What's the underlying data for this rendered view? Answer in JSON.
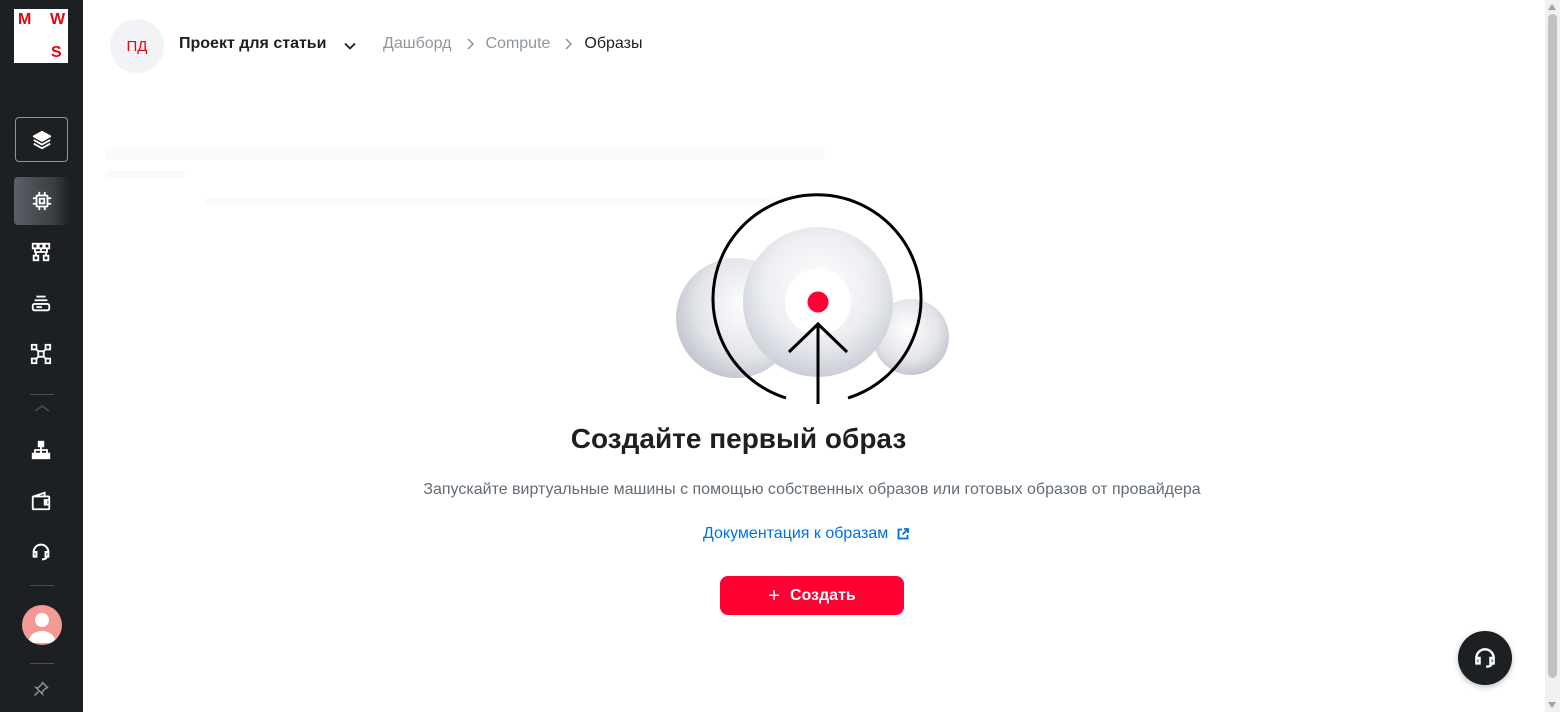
{
  "logo": {
    "letter_m": "M",
    "letter_w": "W",
    "letter_s": "S"
  },
  "sidebar": {
    "items": [
      {
        "name": "layers-icon"
      },
      {
        "name": "chip-icon",
        "active": true
      },
      {
        "name": "network-icon"
      },
      {
        "name": "storage-icon"
      },
      {
        "name": "kubernetes-icon"
      },
      {
        "name": "org-structure-icon"
      },
      {
        "name": "wallet-icon"
      },
      {
        "name": "headset-icon"
      }
    ],
    "pin_icon": "pin-icon"
  },
  "header": {
    "project_initials": "ПД",
    "project_name": "Проект для статьи",
    "breadcrumbs": [
      "Дашборд",
      "Compute",
      "Образы"
    ]
  },
  "empty_state": {
    "title": "Создайте первый образ",
    "description": "Запускайте виртуальные машины с помощью собственных образов или готовых образов от провайдера",
    "doc_link": "Документация к образам",
    "create_button": "Создать"
  },
  "colors": {
    "accent": "#ff0032",
    "link": "#0070e5",
    "sidebar_bg": "#1d2023",
    "brand_red": "#e30611"
  }
}
